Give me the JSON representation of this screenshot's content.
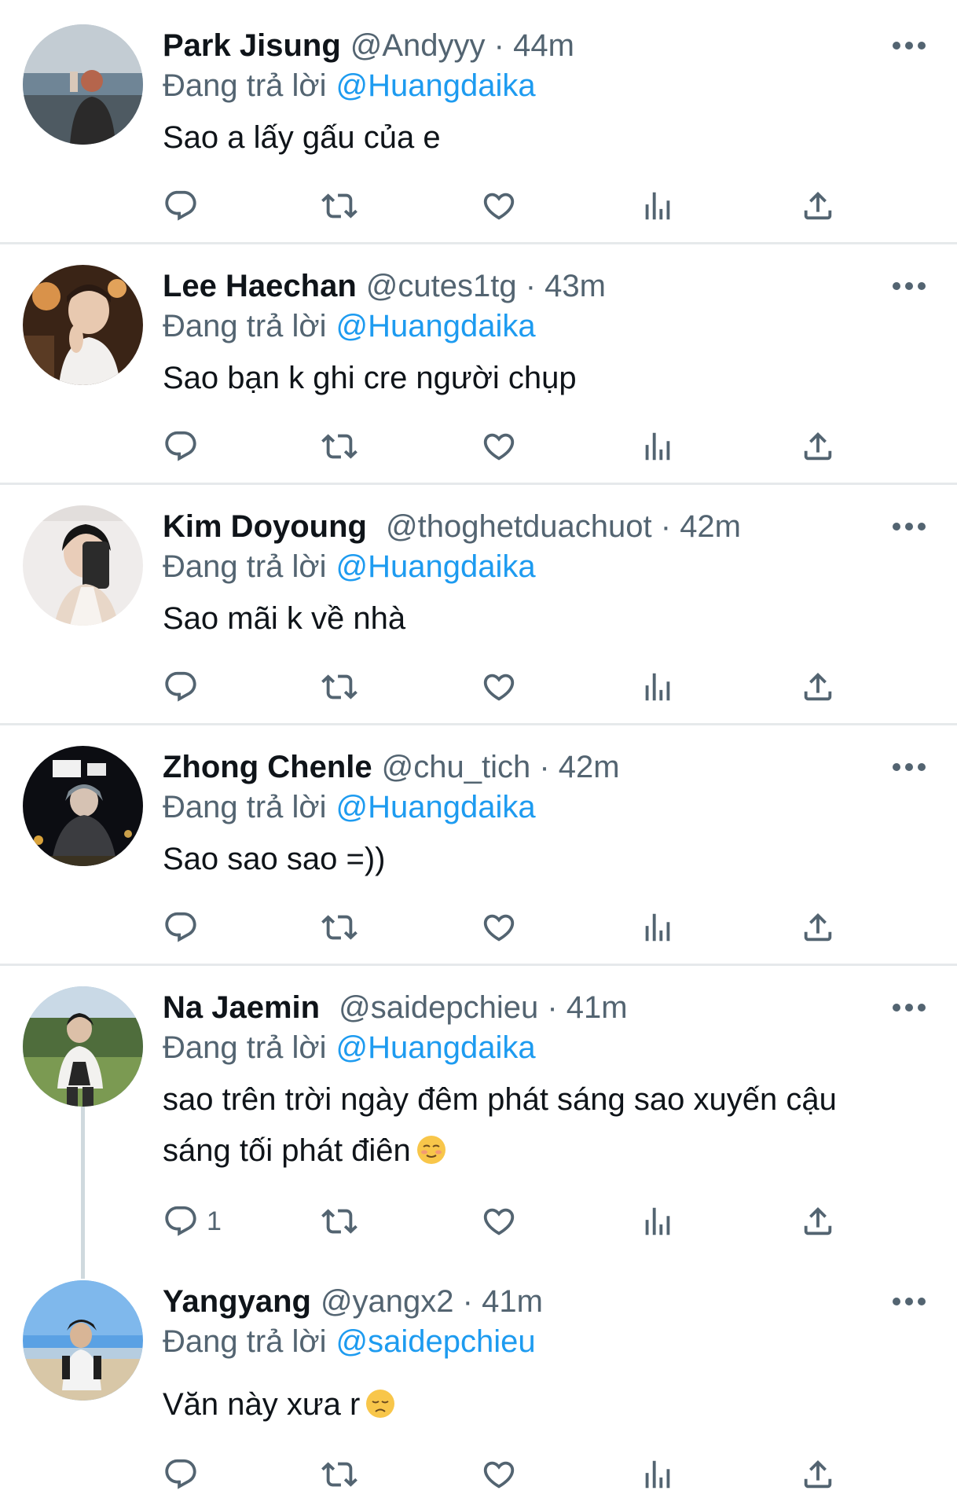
{
  "reply_prefix": "Đang trả lời",
  "tweets": [
    {
      "name": "Park Jisung",
      "handle": "@Andyyy",
      "time": "44m",
      "reply_to": "@Huangdaika",
      "text": "Sao a lấy gấu của e",
      "reply_count": ""
    },
    {
      "name": "Lee Haechan",
      "handle": "@cutes1tg",
      "time": "43m",
      "reply_to": "@Huangdaika",
      "text": "Sao bạn k ghi cre người chụp",
      "reply_count": ""
    },
    {
      "name": "Kim Doyoung",
      "handle": "@thoghetduachuot",
      "time": "42m",
      "reply_to": "@Huangdaika",
      "text": "Sao mãi k về nhà",
      "reply_count": ""
    },
    {
      "name": "Zhong Chenle",
      "handle": "@chu_tich",
      "time": "42m",
      "reply_to": "@Huangdaika",
      "text": "Sao sao sao =))",
      "reply_count": ""
    },
    {
      "name": "Na Jaemin",
      "handle": "@saidepchieu",
      "time": "41m",
      "reply_to": "@Huangdaika",
      "text": "sao trên trời ngày đêm phát sáng sao xuyến cậu sáng tối phát điên",
      "reply_count": "1"
    },
    {
      "name": "Yangyang",
      "handle": "@yangx2",
      "time": "41m",
      "reply_to": "@saidepchieu",
      "text": "Văn này xưa r",
      "reply_count": ""
    }
  ],
  "icons": {
    "reply": "reply-icon",
    "retweet": "retweet-icon",
    "like": "heart-icon",
    "views": "analytics-icon",
    "share": "share-icon",
    "more": "more-dots-icon"
  },
  "colors": {
    "text": "#0f1419",
    "secondary": "#536471",
    "link": "#1d9bf0",
    "divider": "#e6e9eb"
  }
}
